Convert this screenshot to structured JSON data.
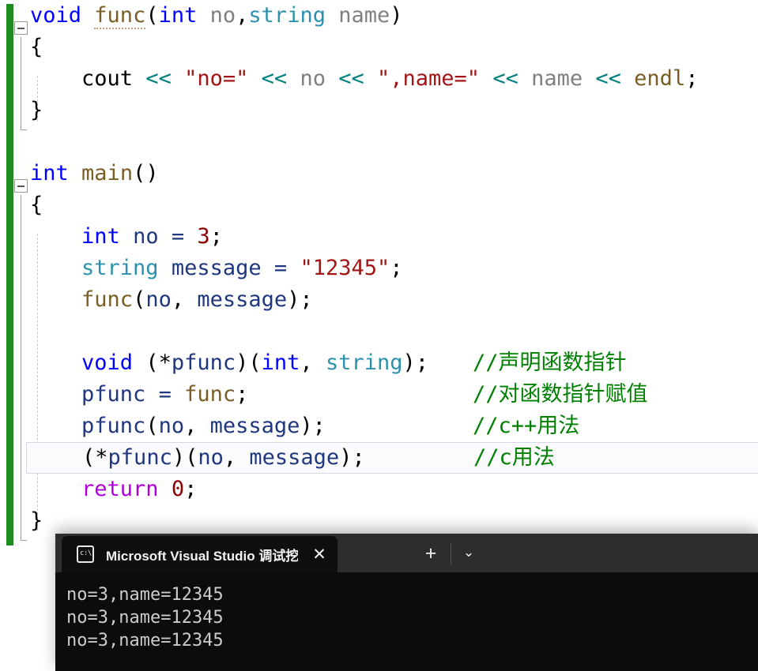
{
  "editor": {
    "change_bar_color": "#1E8B1E",
    "current_line_index": 13,
    "lines": [
      {
        "n": 0,
        "code": "void func(int no,string name)",
        "comment": ""
      },
      {
        "n": 1,
        "code": "{",
        "comment": ""
      },
      {
        "n": 2,
        "code": "    cout << \"no=\" << no << \",name=\" << name << endl;",
        "comment": ""
      },
      {
        "n": 3,
        "code": "}",
        "comment": ""
      },
      {
        "n": 4,
        "code": "",
        "comment": ""
      },
      {
        "n": 5,
        "code": "int main()",
        "comment": ""
      },
      {
        "n": 6,
        "code": "{",
        "comment": ""
      },
      {
        "n": 7,
        "code": "    int no = 3;",
        "comment": ""
      },
      {
        "n": 8,
        "code": "    string message = \"12345\";",
        "comment": ""
      },
      {
        "n": 9,
        "code": "    func(no, message);",
        "comment": ""
      },
      {
        "n": 10,
        "code": "",
        "comment": ""
      },
      {
        "n": 11,
        "code": "    void (*pfunc)(int, string);",
        "comment": "//声明函数指针"
      },
      {
        "n": 12,
        "code": "    pfunc = func;",
        "comment": "//对函数指针赋值"
      },
      {
        "n": 13,
        "code": "    pfunc(no, message);",
        "comment": "//c++用法"
      },
      {
        "n": 14,
        "code": "    (*pfunc)(no, message);",
        "comment": "//c用法"
      },
      {
        "n": 15,
        "code": "    return 0;",
        "comment": ""
      },
      {
        "n": 16,
        "code": "}",
        "comment": ""
      }
    ],
    "colors": {
      "keyword": "#0000FF",
      "type": "#2B91AF",
      "function": "#795E26",
      "number": "#8B0000",
      "string": "#A31515",
      "comment": "#008000",
      "local": "#1F377F",
      "unreferenced": "#808080",
      "stream_operator": "#008080",
      "return_keyword": "#AF00DB",
      "plain": "#000000"
    }
  },
  "terminal": {
    "tab": {
      "icon": "console-icon",
      "icon_text": "c:\\",
      "title": "Microsoft Visual Studio 调试挖",
      "close_label": "✕"
    },
    "new_tab_label": "+",
    "dropdown_label": "⌄",
    "output": [
      "no=3,name=12345",
      "no=3,name=12345",
      "no=3,name=12345"
    ]
  }
}
